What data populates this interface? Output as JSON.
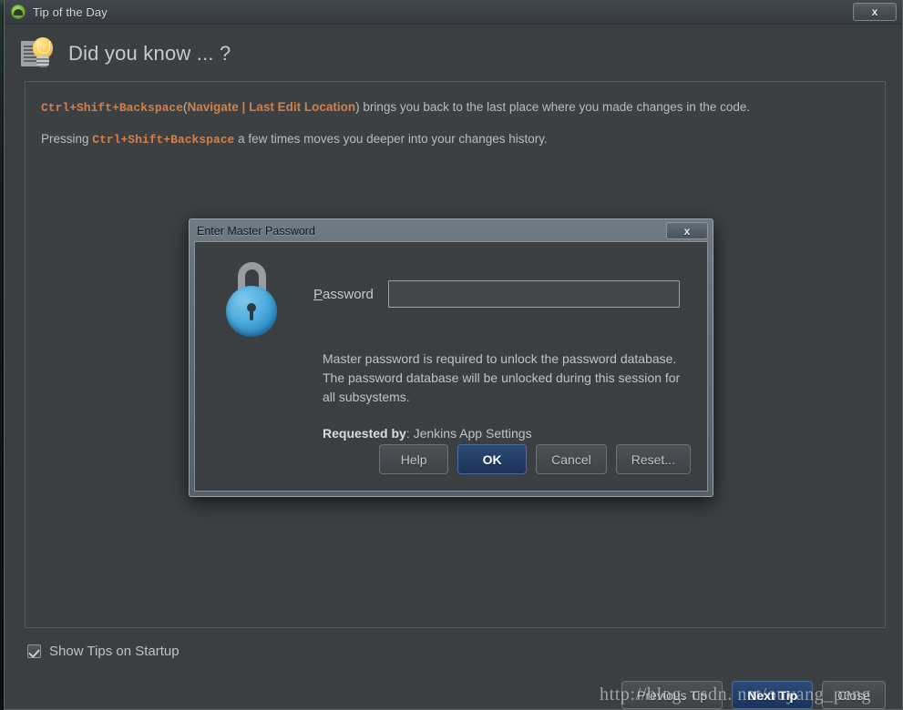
{
  "window": {
    "title": "Tip of the Day",
    "icon": "android-studio-icon",
    "close_label": "x"
  },
  "header": {
    "title": "Did you know ... ?",
    "icon": "lightbulb-tip-icon"
  },
  "tip": {
    "paragraph1": {
      "shortcut": "Ctrl+Shift+Backspace",
      "open_paren": "(",
      "menu_path": "Navigate | Last Edit Location",
      "close_paren": ")",
      "text": " brings you back to the last place where you made changes in the code."
    },
    "paragraph2": {
      "prefix": "Pressing ",
      "shortcut": "Ctrl+Shift+Backspace",
      "suffix": " a few times moves you deeper into your changes history."
    }
  },
  "footer": {
    "show_tips_label": "Show Tips on Startup",
    "show_tips_checked": true,
    "previous_tip": "Previous Tip",
    "next_tip": "Next Tip",
    "close": "Close"
  },
  "dialog": {
    "title": "Enter Master Password",
    "close_label": "x",
    "icon": "padlock-icon",
    "password_label_underlined": "P",
    "password_label_rest": "assword",
    "password_value": "",
    "password_placeholder": "",
    "description": "Master password is required to unlock the password database. The password database will be unlocked during this session for all subsystems.",
    "requested_by_label": "Requested by",
    "requested_by_sep": ": ",
    "requested_by_value": "Jenkins App Settings",
    "buttons": {
      "help": "Help",
      "ok": "OK",
      "cancel": "Cancel",
      "reset": "Reset..."
    }
  },
  "watermark": {
    "text": "http://blog. csdn. net/ouyang_peng"
  },
  "colors": {
    "accent_orange": "#d2804a",
    "default_button_blue": "#24416a",
    "lock_blue": "#2a89c4",
    "window_bg": "#3c3f41"
  }
}
